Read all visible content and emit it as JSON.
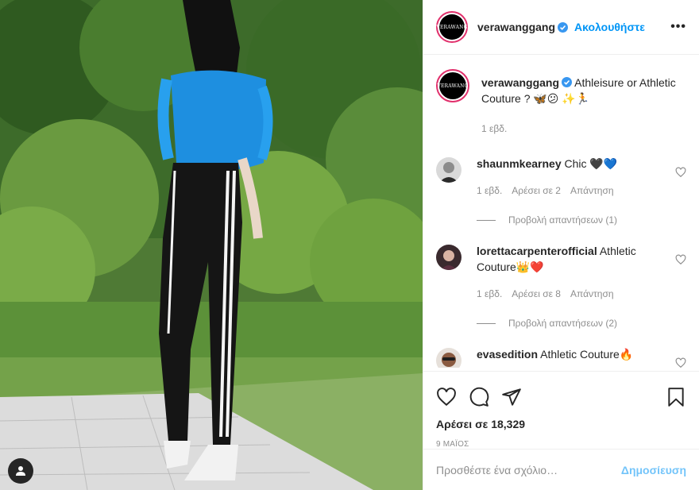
{
  "post": {
    "author": "verawanggang",
    "avatar_text": "VERAWANG",
    "follow_label": "Ακολουθήστε",
    "more_label": "•••",
    "caption_text": "Athleisure or Athletic Couture ? 🦋😕 ✨🏃",
    "caption_time": "1 εβδ.",
    "likes": "Αρέσει σε 18,329",
    "date": "9 ΜΑΪΟΣ",
    "comment_placeholder": "Προσθέστε ένα σχόλιο…",
    "post_label": "Δημοσίευση"
  },
  "comments": [
    {
      "user": "shaunmkearney",
      "text": "Chic 🖤💙",
      "time": "1 εβδ.",
      "likes": "Αρέσει σε 2",
      "reply": "Απάντηση",
      "view_replies": "Προβολή απαντήσεων (1)"
    },
    {
      "user": "lorettacarpenterofficial",
      "text": "Athletic Couture👑❤️",
      "time": "1 εβδ.",
      "likes": "Αρέσει σε 8",
      "reply": "Απάντηση",
      "view_replies": "Προβολή απαντήσεων (2)"
    },
    {
      "user": "evasedition",
      "text": "Athletic Couture🔥"
    }
  ],
  "icons": {
    "like": "heart-icon",
    "comment": "comment-icon",
    "share": "share-icon",
    "save": "bookmark-icon",
    "tags": "user-tag-icon",
    "verified": "verified-badge-icon"
  },
  "colors": {
    "accent": "#0095f6",
    "text": "#262626",
    "muted": "#8e8e8e",
    "border": "#efefef"
  }
}
